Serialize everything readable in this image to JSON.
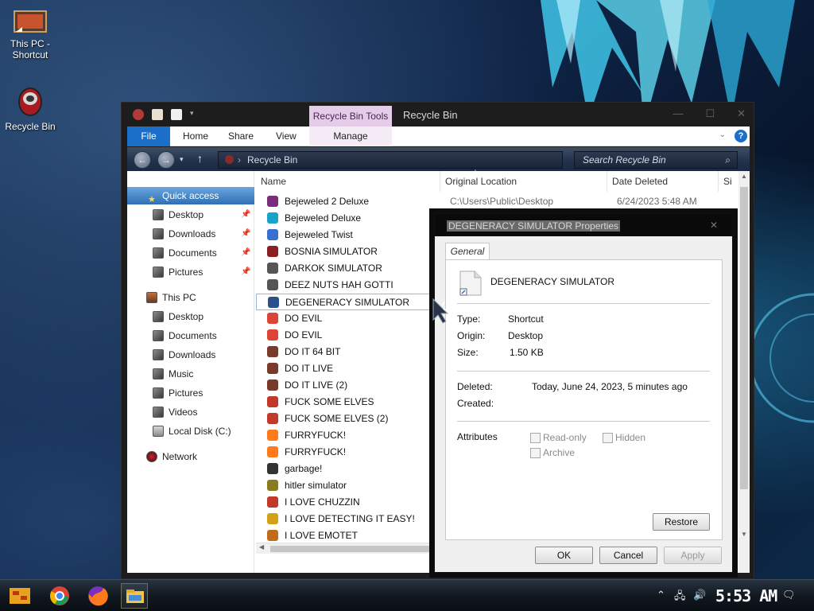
{
  "desktop": {
    "icons": [
      {
        "label": "This PC -\nShortcut",
        "label_line1": "This PC -",
        "label_line2": "Shortcut"
      },
      {
        "label": "Recycle Bin"
      }
    ]
  },
  "explorer": {
    "tools_tab": "Recycle Bin Tools",
    "title": "Recycle Bin",
    "ribbon_tabs": [
      "File",
      "Home",
      "Share",
      "View",
      "Manage"
    ],
    "address": "Recycle Bin",
    "search_placeholder": "Search Recycle Bin",
    "nav": {
      "quick_access": "Quick access",
      "quick_items": [
        "Desktop",
        "Downloads",
        "Documents",
        "Pictures"
      ],
      "this_pc": "This PC",
      "pc_items": [
        "Desktop",
        "Documents",
        "Downloads",
        "Music",
        "Pictures",
        "Videos",
        "Local Disk (C:)"
      ],
      "network": "Network"
    },
    "columns": [
      "Name",
      "Original Location",
      "Date Deleted",
      "Si"
    ],
    "files": [
      {
        "name": "Bejeweled 2 Deluxe",
        "location": "C:\\Users\\Public\\Desktop",
        "date": "6/24/2023 5:48 AM"
      },
      {
        "name": "Bejeweled Deluxe"
      },
      {
        "name": "Bejeweled Twist"
      },
      {
        "name": "BOSNIA SIMULATOR"
      },
      {
        "name": "DARKOK SIMULATOR"
      },
      {
        "name": "DEEZ NUTS HAH GOTTI"
      },
      {
        "name": "DEGENERACY SIMULATOR"
      },
      {
        "name": "DO EVIL"
      },
      {
        "name": "DO EVIL"
      },
      {
        "name": "DO IT 64 BIT"
      },
      {
        "name": "DO IT LIVE"
      },
      {
        "name": "DO IT LIVE (2)"
      },
      {
        "name": "FUCK SOME ELVES"
      },
      {
        "name": "FUCK SOME ELVES (2)"
      },
      {
        "name": "FURRYFUCK!"
      },
      {
        "name": "FURRYFUCK!"
      },
      {
        "name": "garbage!"
      },
      {
        "name": "hitler simulator"
      },
      {
        "name": "I LOVE CHUZZIN"
      },
      {
        "name": "I LOVE DETECTING IT EASY!"
      },
      {
        "name": "I LOVE EMOTET"
      }
    ]
  },
  "dialog": {
    "title": "DEGENERACY SIMULATOR Properties",
    "tab": "General",
    "file_name": "DEGENERACY SIMULATOR",
    "type_label": "Type:",
    "type_value": "Shortcut",
    "origin_label": "Origin:",
    "origin_value": "Desktop",
    "size_label": "Size:",
    "size_value": "1.50 KB",
    "deleted_label": "Deleted:",
    "deleted_value": "Today, June 24, 2023, 5 minutes ago",
    "created_label": "Created:",
    "attributes_label": "Attributes",
    "attr_readonly": "Read-only",
    "attr_hidden": "Hidden",
    "attr_archive": "Archive",
    "restore": "Restore",
    "ok": "OK",
    "cancel": "Cancel",
    "apply": "Apply"
  },
  "taskbar": {
    "clock": "5:53 AM"
  },
  "colors": {
    "accent": "#1b6fc9",
    "tools_tab": "#e5cdea",
    "selection": "#2f70b4"
  }
}
